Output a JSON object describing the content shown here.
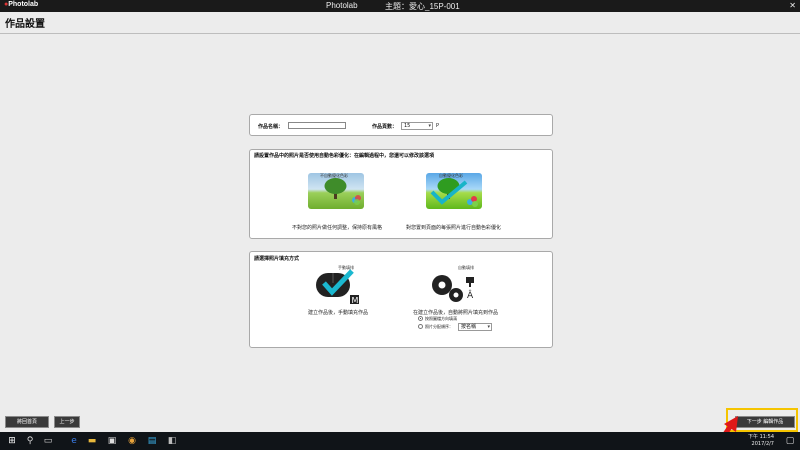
{
  "window": {
    "logo": "Photolab",
    "title": "Photolab",
    "theme": "主題：愛心_15P-001",
    "close_glyph": "✕"
  },
  "page": {
    "title": "作品設置"
  },
  "panel_settings": {
    "name_label": "作品名稱：",
    "name_value": "",
    "pages_label": "作品頁數：",
    "pages_value": "15",
    "pages_unit": "P"
  },
  "panel_optimize": {
    "heading": "請設置作品中的照片是否使用自動色彩優化：在編輯過程中，您還可以修改該選項",
    "options": [
      {
        "caption": "不自動優化色彩",
        "desc": "不對您的照片做任何調整，保持原有風格"
      },
      {
        "caption": "自動優化色彩",
        "desc": "對您置到頁面的每張照片進行自動色彩優化"
      }
    ]
  },
  "panel_fill": {
    "heading": "請選擇照片填充方式",
    "options": [
      {
        "caption": "手動填排",
        "badge": "M",
        "desc": "建立作品後，手動填充作品"
      },
      {
        "caption": "自動填排",
        "badge": "A",
        "desc": "在建立作品後，自動將照片填充到作品"
      }
    ],
    "radio_1": "按照圖檔方向填滿",
    "radio_2_label": "照片分配順序：",
    "radio_2_select": "按名稱"
  },
  "footer": {
    "left_buttons": [
      "將回首頁",
      "上一步"
    ],
    "next_button": "下一步 編輯作品"
  },
  "taskbar": {
    "time": "下午 11:54",
    "date": "2017/2/7"
  },
  "colors": {
    "highlight": "#f5c400",
    "arrow": "#e01818",
    "accent": "#18b4c8"
  }
}
